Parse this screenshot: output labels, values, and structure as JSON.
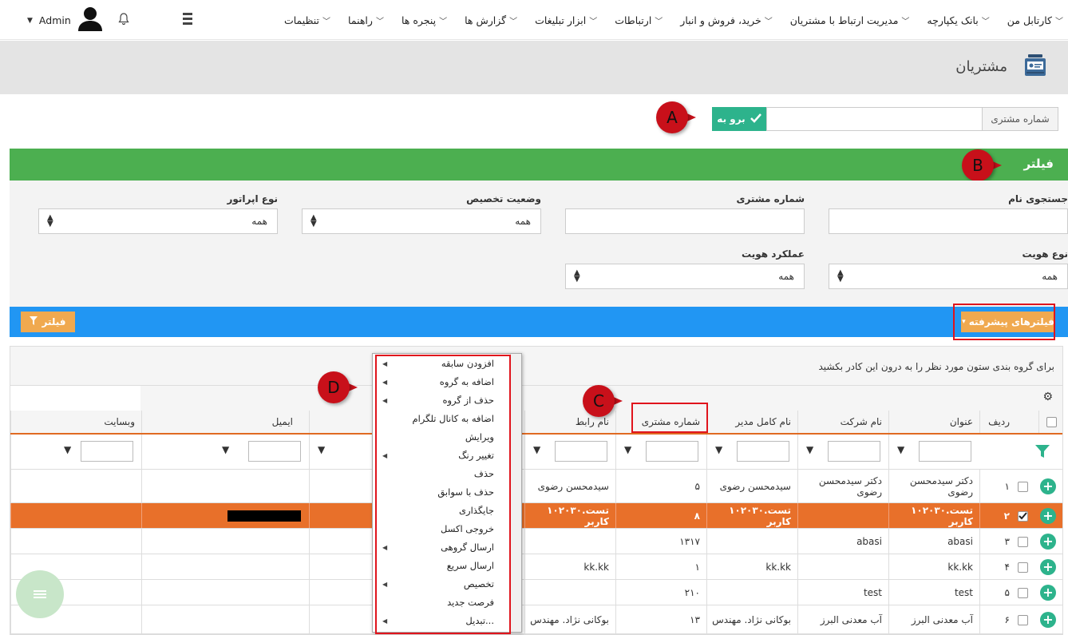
{
  "topbar": {
    "menu": [
      "کارتابل من",
      "بانک یکپارچه",
      "مدیریت ارتباط با مشتریان",
      "خرید، فروش و انبار",
      "ارتباطات",
      "ابزار تبلیغات",
      "گزارش ها",
      "پنجره ها",
      "راهنما",
      "تنظیمات"
    ],
    "user_name": "Admin"
  },
  "page": {
    "title": "مشتریان"
  },
  "customer_number": {
    "label": "شماره مشتری",
    "go_label": "برو به"
  },
  "markers": {
    "a": "A",
    "b": "B",
    "c": "C",
    "d": "D"
  },
  "filter": {
    "title": "فیلتر",
    "fields": {
      "name_search": {
        "label": "جستجوی نام"
      },
      "customer_number": {
        "label": "شماره مشتری"
      },
      "allocation_status": {
        "label": "وضعیت تخصیص",
        "value": "همه"
      },
      "operator_type": {
        "label": "نوع اپراتور",
        "value": "همه"
      },
      "identity_type": {
        "label": "نوع هویت",
        "value": "همه"
      },
      "identity_function": {
        "label": "عملکرد هویت",
        "value": "همه"
      }
    }
  },
  "toolbar": {
    "advanced_filters": "فیلترهای پیشرفته",
    "filter_button": "فیلتر"
  },
  "grid": {
    "group_hint": "برای گروه بندی ستون مورد نظر را به درون این کادر بکشید",
    "columns": [
      "ردیف",
      "عنوان",
      "نام شرکت",
      "نام کامل مدیر",
      "شماره مشتری",
      "نام رابط",
      "ایمیل",
      "وبسایت"
    ],
    "rows": [
      {
        "n": "۱",
        "title": "دکتر سیدمحسن رضوی",
        "company": "دکتر سیدمحسن رضوی",
        "manager": "سیدمحسن رضوی",
        "number": "۵",
        "contact": "سیدمحسن رضوی"
      },
      {
        "n": "۲",
        "title": "۱۰۲۰۳۰.تست کاربر",
        "company": "",
        "manager": "۱۰۲۰۳۰.تست کاربر",
        "number": "۸",
        "contact": "۱۰۲۰۳۰.تست کاربر"
      },
      {
        "n": "۳",
        "title": "abasi",
        "company": "abasi",
        "manager": "",
        "number": "۱۳۱۷",
        "contact": ""
      },
      {
        "n": "۴",
        "title": "kk.kk",
        "company": "",
        "manager": "kk.kk",
        "number": "۱",
        "contact": "kk.kk"
      },
      {
        "n": "۵",
        "title": "test",
        "company": "test",
        "manager": "",
        "number": "۲۱۰",
        "contact": ""
      },
      {
        "n": "۶",
        "title": "آب معدنی البرز",
        "company": "آب معدنی البرز",
        "manager": "بوکانی نژاد. مهندس",
        "number": "۱۳",
        "contact": "بوکانی نژاد. مهندس"
      }
    ]
  },
  "context_menu": [
    {
      "label": "افزودن سابقه",
      "sub": true
    },
    {
      "label": "اضافه به گروه",
      "sub": true
    },
    {
      "label": "حذف از گروه",
      "sub": true
    },
    {
      "label": "اضافه به کانال تلگرام",
      "sub": false
    },
    {
      "label": "ویرایش",
      "sub": false
    },
    {
      "label": "تغییر رنگ",
      "sub": true
    },
    {
      "label": "حذف",
      "sub": false
    },
    {
      "label": "حذف با سوابق",
      "sub": false
    },
    {
      "label": "جایگذاری",
      "sub": false
    },
    {
      "label": "خروجی اکسل",
      "sub": false
    },
    {
      "label": "ارسال گروهی",
      "sub": true
    },
    {
      "label": "ارسال سریع",
      "sub": false
    },
    {
      "label": "تخصیص",
      "sub": true
    },
    {
      "label": "فرصت جدید",
      "sub": false
    },
    {
      "label": "تبدیل...",
      "sub": true
    }
  ]
}
